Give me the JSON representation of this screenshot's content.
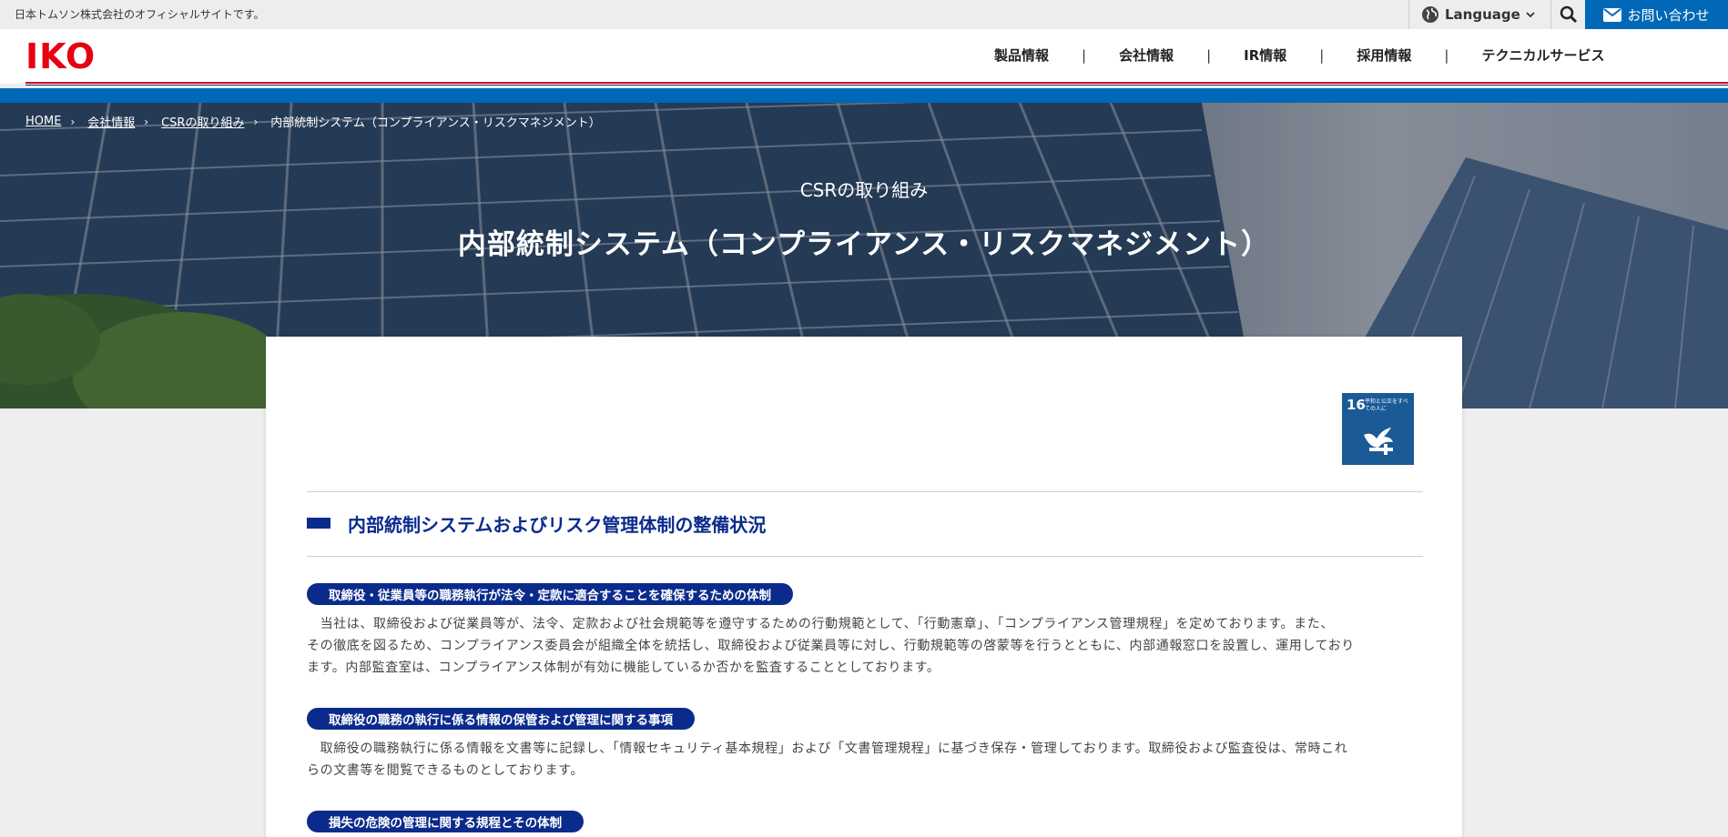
{
  "topbar": {
    "tagline": "日本トムソン株式会社のオフィシャルサイトです。",
    "language_label": "Language",
    "contact_label": "お問い合わせ"
  },
  "header": {
    "logo_text": "IKO",
    "nav": [
      "製品情報",
      "会社情報",
      "IR情報",
      "採用情報",
      "テクニカルサービス"
    ]
  },
  "breadcrumb": [
    "HOME",
    "会社情報",
    "CSRの取り組み",
    "内部統制システム（コンプライアンス・リスクマネジメント）"
  ],
  "hero": {
    "subtitle": "CSRの取り組み",
    "title": "内部統制システム（コンプライアンス・リスクマネジメント）"
  },
  "sdg_badge": {
    "number": "16",
    "label": "平和と公正をすべての人に"
  },
  "content": {
    "heading": "内部統制システムおよびリスク管理体制の整備状況",
    "sections": [
      {
        "title": "取締役・従業員等の職務執行が法令・定款に適合することを確保するための体制",
        "lines": [
          "　当社は、取締役および従業員等が、法令、定款および社会規範等を遵守するための行動規範として、「行動憲章」、「コンプライアンス管理規程」を定めております。また、",
          "その徹底を図るため、コンプライアンス委員会が組織全体を統括し、取締役および従業員等に対し、行動規範等の啓蒙等を行うとともに、内部通報窓口を設置し、運用しており",
          "ます。内部監査室は、コンプライアンス体制が有効に機能しているか否かを監査することとしております。"
        ]
      },
      {
        "title": "取締役の職務の執行に係る情報の保管および管理に関する事項",
        "lines": [
          "　取締役の職務執行に係る情報を文書等に記録し、「情報セキュリティ基本規程」および「文書管理規程」に基づき保存・管理しております。取締役および監査役は、常時これ",
          "らの文書等を閲覧できるものとしております。"
        ]
      },
      {
        "title": "損失の危険の管理に関する規程とその体制",
        "lines": []
      }
    ]
  }
}
